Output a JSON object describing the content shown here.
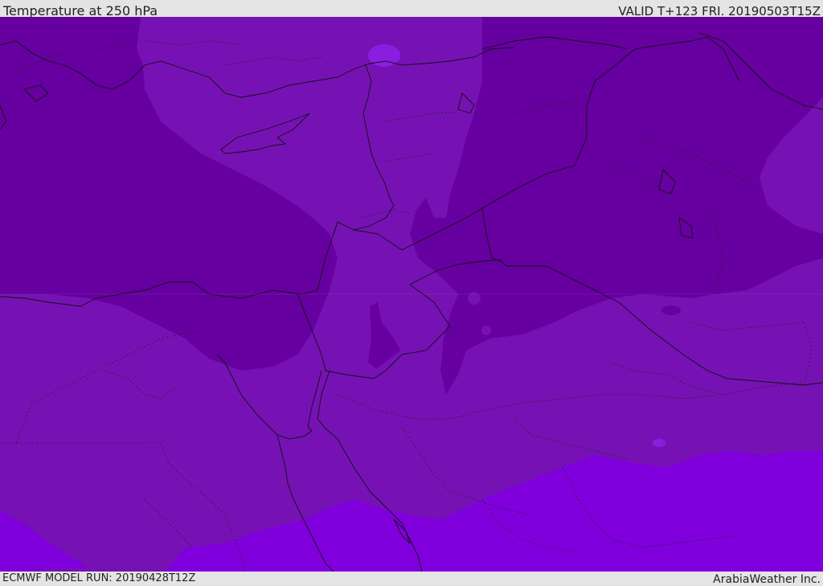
{
  "header": {
    "title": "Temperature at 250 hPa",
    "valid": "VALID T+123 FRI. 20190503T15Z"
  },
  "footer": {
    "model_run": "ECMWF MODEL RUN: 20190428T12Z",
    "brand": "ArabiaWeather Inc."
  },
  "map": {
    "field": "temperature",
    "level": "250 hPa",
    "colors": {
      "cold_band": "#6600a0",
      "mid_band": "#7612b4",
      "warm_band": "#7f00dc",
      "coastline": "#111111",
      "border": "#111111"
    }
  }
}
